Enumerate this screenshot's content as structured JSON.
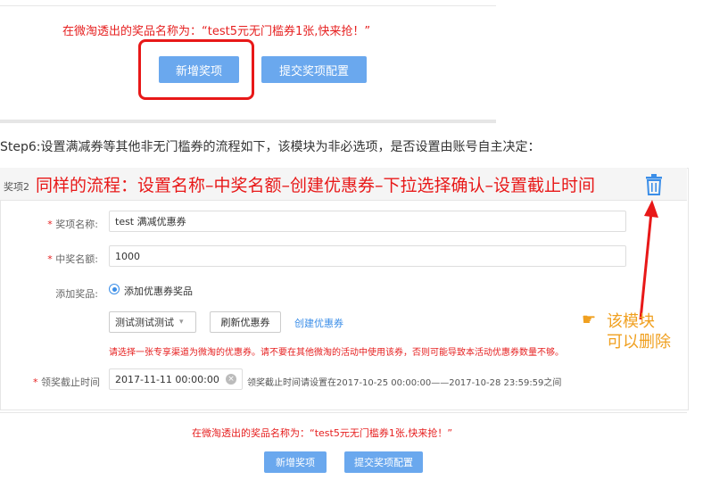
{
  "top": {
    "prize_text": "在微淘透出的奖品名称为：“test5元无门槛券1张,快来抢！”",
    "add_button": "新增奖项",
    "submit_button": "提交奖项配置"
  },
  "step_text": "Step6:设置满减券等其他非无门槛券的流程如下，该模块为非必选项，是否设置由账号自主决定：",
  "panel": {
    "header_label": "奖项2",
    "header_annotation": "同样的流程：设置名称–中奖名额–创建优惠券–下拉选择确认–设置截止时间",
    "name_label": "奖项名称:",
    "name_value": "test 满减优惠券",
    "count_label": "中奖名额:",
    "count_value": "1000",
    "add_prize_label": "添加奖品:",
    "add_coupon_option": "添加优惠券奖品",
    "select_value": "测试测试测试",
    "refresh_button": "刷新优惠券",
    "create_link": "创建优惠券",
    "warning": "请选择一张专享渠道为微淘的优惠券。请不要在其他微淘的活动中使用该券，否则可能导致本活动优惠券数量不够。",
    "deadline_label": "领奖截止时间",
    "deadline_value": "2017-11-11 00:00:00",
    "deadline_hint": "领奖截止时间请设置在2017-10-25 00:00:00——2017-10-28 23:59:59之间"
  },
  "side_annotation": {
    "line1": "该模块",
    "line2": "可以删除"
  },
  "bottom": {
    "prize_text": "在微淘透出的奖品名称为：“test5元无门槛券1张,快来抢！”",
    "add_button": "新增奖项",
    "submit_button": "提交奖项配置"
  },
  "colors": {
    "accent_blue": "#6aa8ee",
    "annotation_red": "#e81818",
    "annotation_orange": "#f0a020"
  }
}
